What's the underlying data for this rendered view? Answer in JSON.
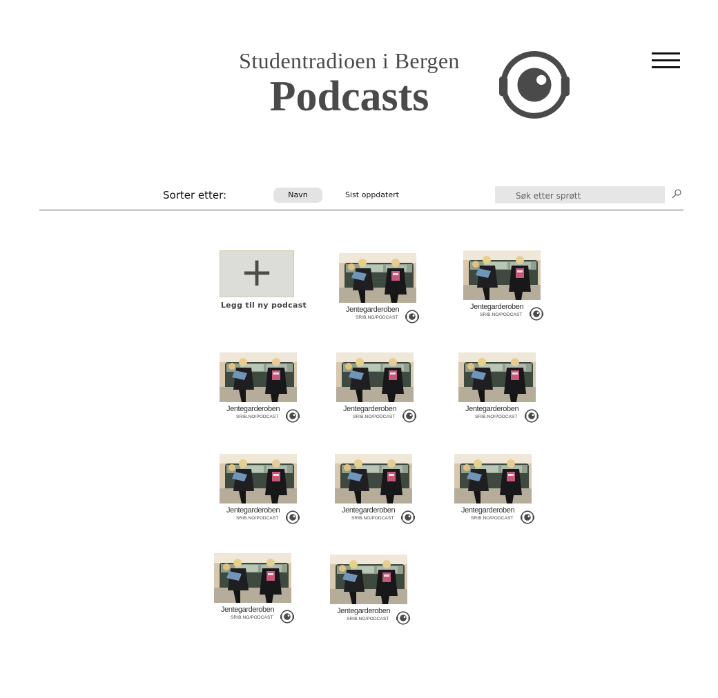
{
  "header": {
    "title_line1": "Studentradioen i Bergen",
    "title_line2": "Podcasts",
    "logo_icon": "srib-eye-logo-icon",
    "menu_icon": "hamburger-menu-icon"
  },
  "toolbar": {
    "sort_label": "Sorter etter:",
    "sort_options": [
      {
        "label": "Navn",
        "active": true
      },
      {
        "label": "Sist oppdatert",
        "active": false
      }
    ],
    "search_placeholder": "Søk etter sprøtt",
    "search_icon": "search-icon"
  },
  "add_tile": {
    "label": "Legg til ny podcast",
    "icon": "plus-icon"
  },
  "podcasts": [
    {
      "title": "Jentegarderoben",
      "subtitle": "SRIB.NO/PODCAST"
    },
    {
      "title": "Jentegarderoben",
      "subtitle": "SRIB.NO/PODCAST"
    },
    {
      "title": "Jentegarderoben",
      "subtitle": "SRIB.NO/PODCAST"
    },
    {
      "title": "Jentegarderoben",
      "subtitle": "SRIB.NO/PODCAST"
    },
    {
      "title": "Jentegarderoben",
      "subtitle": "SRIB.NO/PODCAST"
    },
    {
      "title": "Jentegarderoben",
      "subtitle": "SRIB.NO/PODCAST"
    },
    {
      "title": "Jentegarderoben",
      "subtitle": "SRIB.NO/PODCAST"
    },
    {
      "title": "Jentegarderoben",
      "subtitle": "SRIB.NO/PODCAST"
    },
    {
      "title": "Jentegarderoben",
      "subtitle": "SRIB.NO/PODCAST"
    },
    {
      "title": "Jentegarderoben",
      "subtitle": "SRIB.NO/PODCAST"
    }
  ],
  "colors": {
    "brand_gray": "#4a4a4a",
    "active_sort_bg": "#e3e3e3",
    "search_bg": "#e6e6e6"
  }
}
